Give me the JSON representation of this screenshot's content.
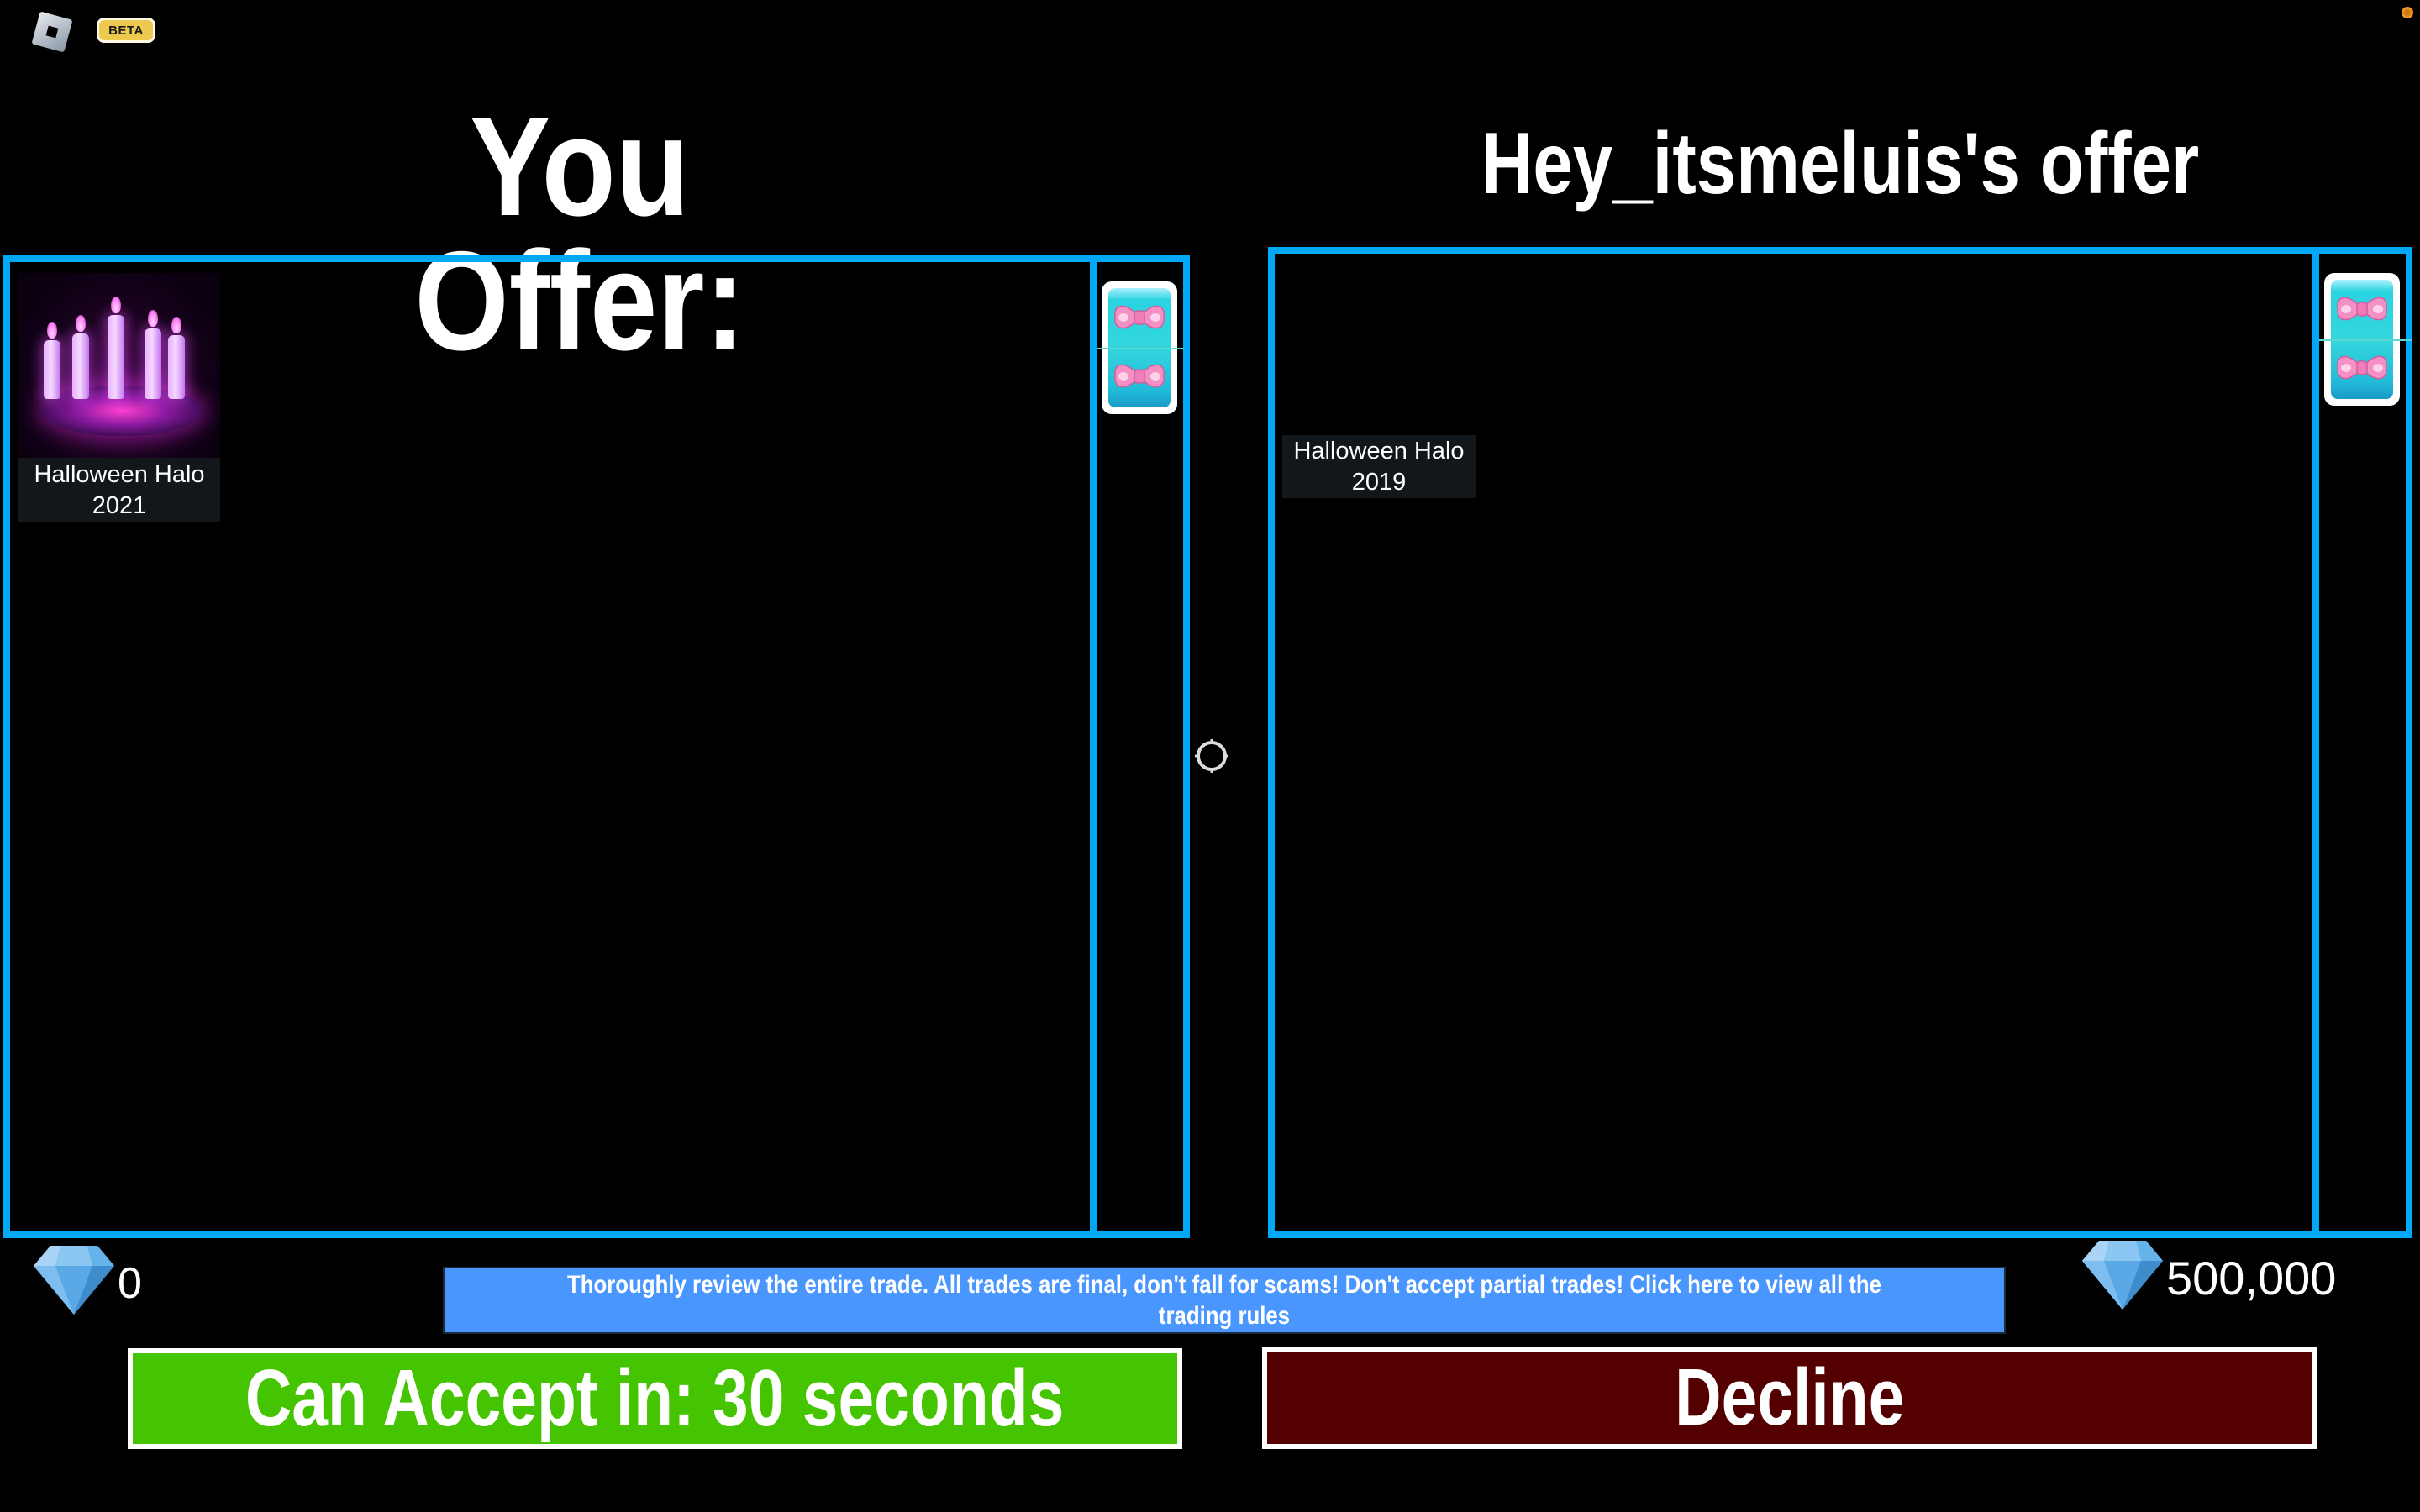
{
  "app": {
    "logo_icon": "roblox-logo-icon",
    "badge": "BETA",
    "notification_icon": "notification-dot-icon"
  },
  "trade": {
    "you": {
      "title": "You Offer:",
      "items": [
        {
          "name_line1": "Halloween Halo",
          "name_line2": "2021",
          "icon": "halloween-halo-2021-image"
        }
      ],
      "side_icon": "bow-gift-card-icon",
      "gems": "0",
      "gem_icon": "diamond-icon"
    },
    "them": {
      "title": "Hey_itsmeluis's offer",
      "items": [
        {
          "name_line1": "Halloween Halo",
          "name_line2": "2019"
        }
      ],
      "side_icon": "bow-gift-card-icon",
      "gems": "500,000",
      "gem_icon": "diamond-icon"
    },
    "notice": "Thoroughly review the entire trade. All trades are final, don't fall for scams! Don't accept partial trades! Click here to view all the trading rules",
    "accept_label": "Can Accept in: 30 seconds",
    "decline_label": "Decline",
    "countdown_seconds": 30
  },
  "colors": {
    "panel_border": "#00a8f5",
    "notice_bg": "#4a96ff",
    "accept_bg": "#45c402",
    "decline_bg": "#540000",
    "beta_badge": "#ecc94f"
  },
  "cursor_icon": "crosshair-cursor-icon"
}
